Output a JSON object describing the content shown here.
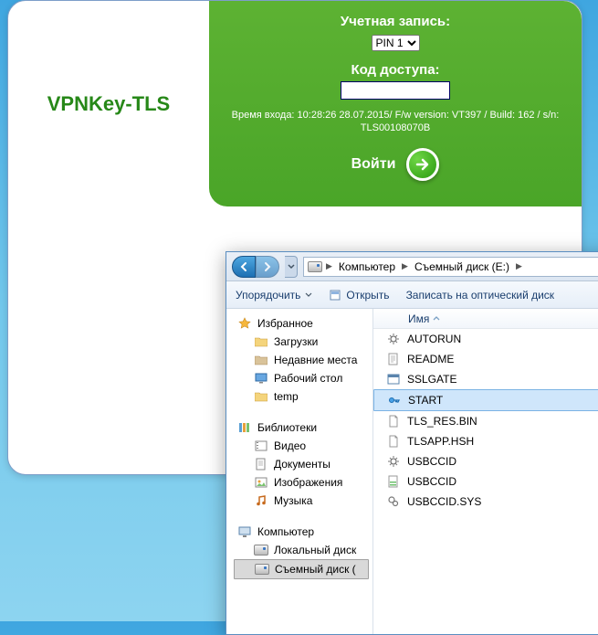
{
  "vpn": {
    "logo": "VPNKey-TLS",
    "account_label": "Учетная запись:",
    "pin_options": [
      "PIN 1"
    ],
    "pin_selected": "PIN 1",
    "code_label": "Код доступа:",
    "code_value": "",
    "info_line1": "Время входа: 10:28:26 28.07.2015/ F/w version: VT397 / Build: 162 / s/n:",
    "info_line2": "TLS00108070B",
    "login_label": "Войти"
  },
  "explorer": {
    "breadcrumbs": [
      "Компьютер",
      "Съемный диск (E:)"
    ],
    "toolbar": {
      "organize": "Упорядочить",
      "open": "Открыть",
      "burn": "Записать на оптический диск"
    },
    "columns": {
      "name": "Имя"
    },
    "tree": {
      "favorites": {
        "label": "Избранное",
        "items": [
          "Загрузки",
          "Недавние места",
          "Рабочий стол",
          "temp"
        ]
      },
      "libraries": {
        "label": "Библиотеки",
        "items": [
          "Видео",
          "Документы",
          "Изображения",
          "Музыка"
        ]
      },
      "computer": {
        "label": "Компьютер",
        "items": [
          "Локальный диск",
          "Съемный диск ("
        ]
      },
      "selected": "Съемный диск ("
    },
    "files": [
      {
        "name": "AUTORUN",
        "icon": "settings"
      },
      {
        "name": "README",
        "icon": "text"
      },
      {
        "name": "SSLGATE",
        "icon": "app"
      },
      {
        "name": "START",
        "icon": "key",
        "selected": true
      },
      {
        "name": "TLS_RES.BIN",
        "icon": "file"
      },
      {
        "name": "TLSAPP.HSH",
        "icon": "file"
      },
      {
        "name": "USBCCID",
        "icon": "settings"
      },
      {
        "name": "USBCCID",
        "icon": "cat"
      },
      {
        "name": "USBCCID.SYS",
        "icon": "sys"
      }
    ]
  }
}
